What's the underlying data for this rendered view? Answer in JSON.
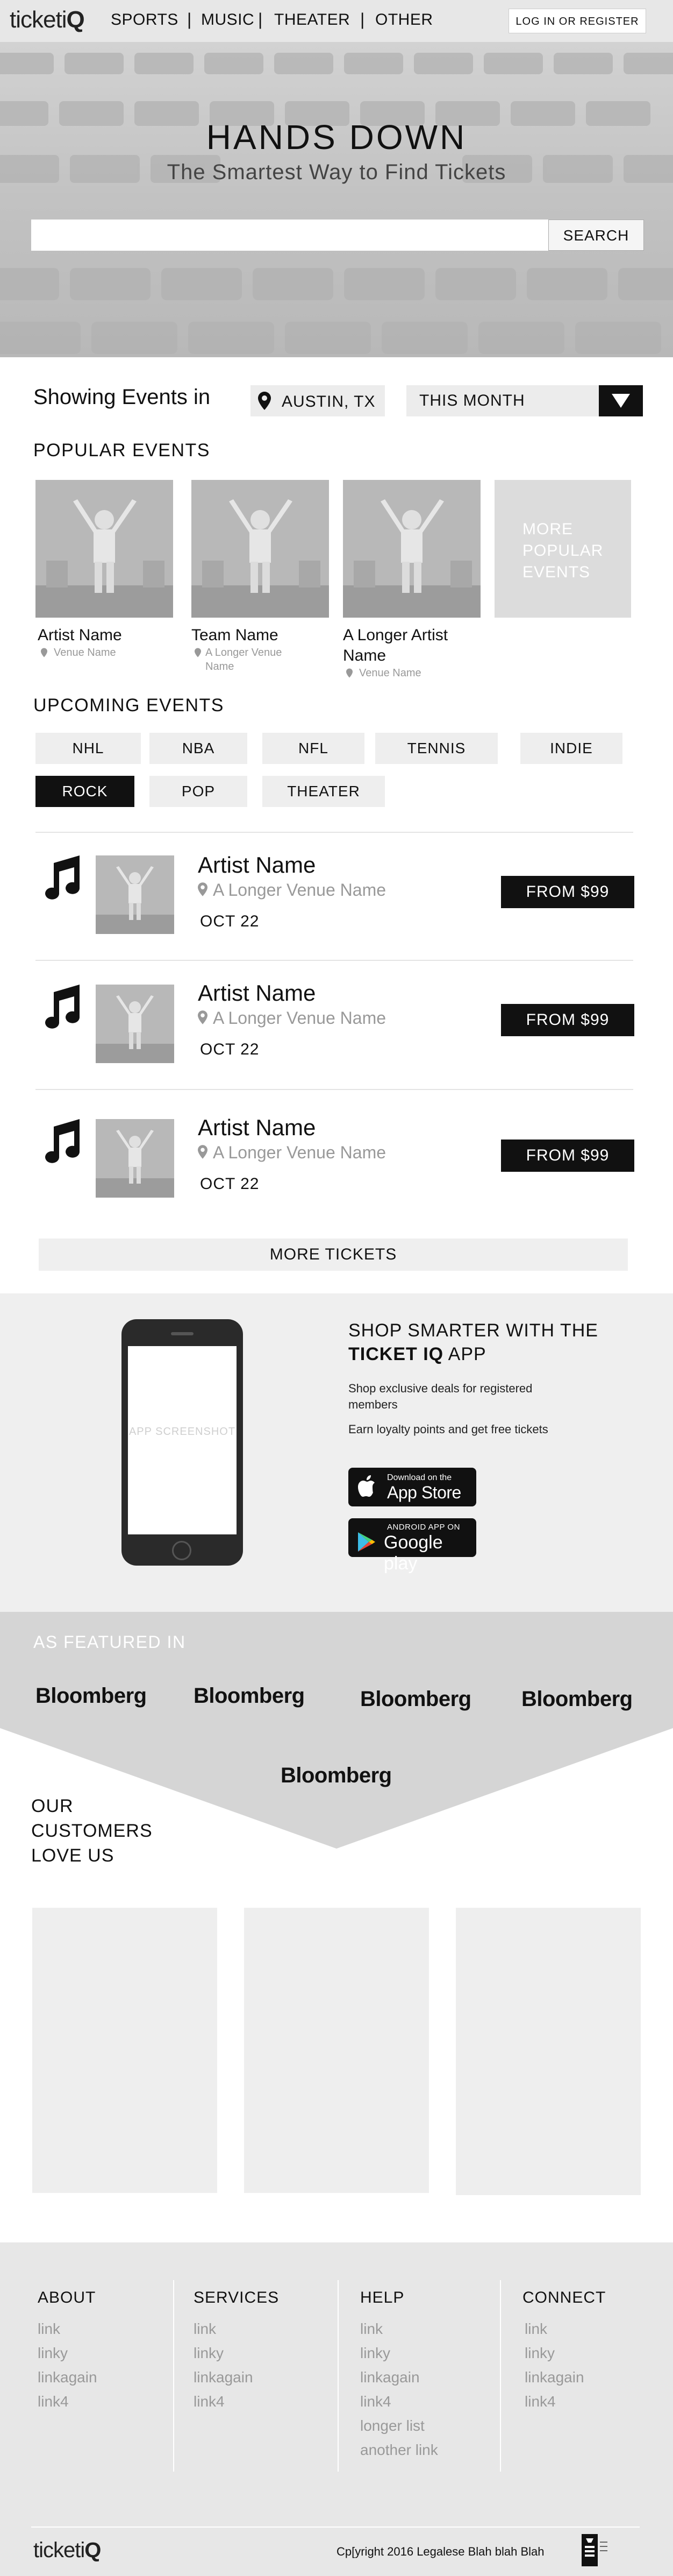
{
  "nav": {
    "logo_text": "ticketi",
    "logo_suffix": "Q",
    "links": [
      "SPORTS",
      "MUSIC",
      "THEATER",
      "OTHER"
    ],
    "separators": [
      "|",
      "|",
      "|"
    ],
    "login_label": "LOG IN OR REGISTER"
  },
  "hero": {
    "title": "HANDS DOWN",
    "subtitle": "The Smartest Way to Find Tickets",
    "search_placeholder": "",
    "search_button": "SEARCH"
  },
  "filters": {
    "showing_label": "Showing Events in",
    "location": "AUSTIN, TX",
    "month": "THIS MONTH",
    "location_icon": "map-pin-icon",
    "dropdown_icon": "triangle-down-icon"
  },
  "popular": {
    "title": "POPULAR EVENTS",
    "cards": [
      {
        "name": "Artist Name",
        "venue": "Venue Name"
      },
      {
        "name": "Team Name",
        "venue": "A Longer Venue Name"
      },
      {
        "name": "A Longer Artist Name",
        "venue": "Venue Name"
      }
    ],
    "more_label": "MORE POPULAR EVENTS"
  },
  "upcoming": {
    "title": "UPCOMING EVENTS",
    "categories": [
      "NHL",
      "NBA",
      "NFL",
      "TENNIS",
      "INDIE",
      "ROCK",
      "POP",
      "THEATER"
    ],
    "active_category": "ROCK",
    "events": [
      {
        "name": "Artist Name",
        "venue": "A Longer Venue Name",
        "date": "OCT 22",
        "price": "FROM $99",
        "icon": "music-note-icon"
      },
      {
        "name": "Artist Name",
        "venue": "A Longer Venue Name",
        "date": "OCT 22",
        "price": "FROM $99",
        "icon": "music-note-icon"
      },
      {
        "name": "Artist Name",
        "venue": "A Longer Venue Name",
        "date": "OCT 22",
        "price": "FROM $99",
        "icon": "music-note-icon"
      }
    ],
    "more_label": "MORE TICKETS"
  },
  "app": {
    "heading_line1": "SHOP SMARTER WITH THE",
    "heading_brand": "TICKET IQ",
    "heading_suffix": " APP",
    "desc1": "Shop exclusive deals for registered members",
    "desc2": "Earn loyalty points and get free tickets",
    "screenshot_label": "APP SCREENSHOT",
    "appstore_small": "Download on the",
    "appstore_big": "App Store",
    "googleplay_small": "ANDROID APP ON",
    "googleplay_big": "Google play"
  },
  "featured": {
    "title": "AS FEATURED IN",
    "logos": [
      "Bloomberg",
      "Bloomberg",
      "Bloomberg",
      "Bloomberg",
      "Bloomberg"
    ]
  },
  "customers": {
    "title": "OUR CUSTOMERS LOVE US"
  },
  "footer": {
    "columns": [
      {
        "title": "ABOUT",
        "links": [
          "link",
          "linky",
          "linkagain",
          "link4"
        ]
      },
      {
        "title": "SERVICES",
        "links": [
          "link",
          "linky",
          "linkagain",
          "link4"
        ]
      },
      {
        "title": "HELP",
        "links": [
          "link",
          "linky",
          "linkagain",
          "link4",
          "longer list",
          "another link"
        ]
      },
      {
        "title": "CONNECT",
        "links": [
          "link",
          "linky",
          "linkagain",
          "link4"
        ]
      }
    ],
    "logo_text": "ticketi",
    "logo_suffix": "Q",
    "copyright": "Cp[yright 2016 Legalese Blah blah Blah",
    "badge_icon": "bbb-accredited-icon"
  },
  "colors": {
    "nav_bg": "#e7e7e7",
    "accent_dark": "#111111",
    "muted_text": "#999999",
    "section_bg": "#efefef",
    "featured_bg": "#d5d5d5"
  }
}
